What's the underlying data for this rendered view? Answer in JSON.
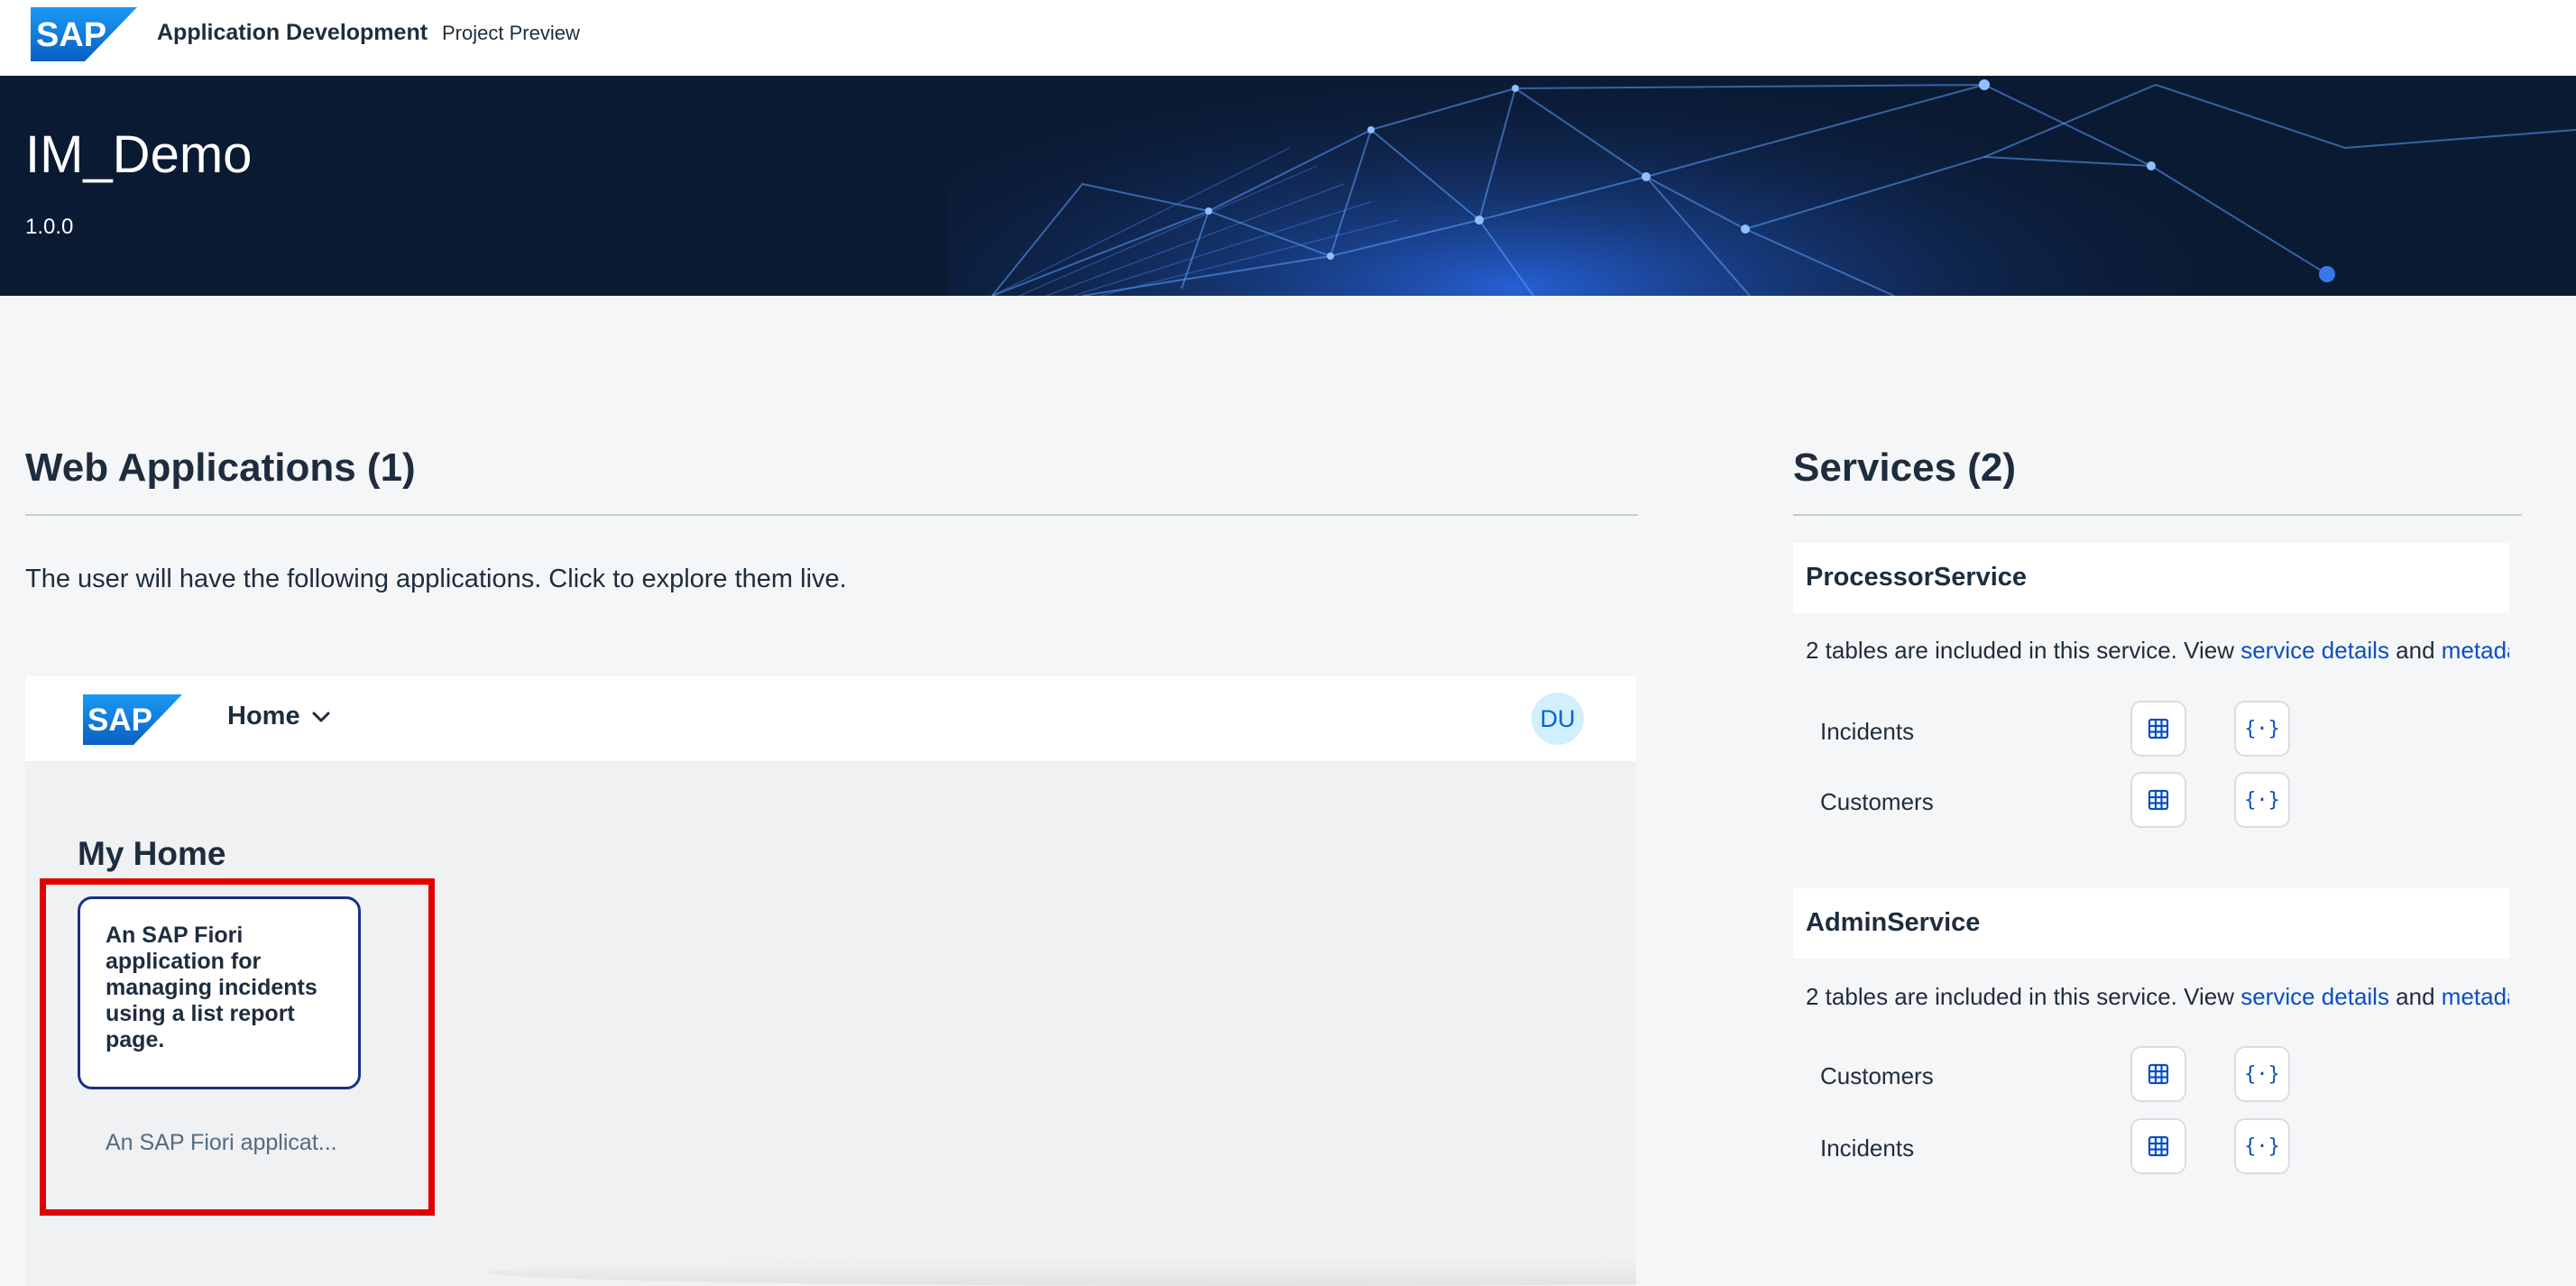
{
  "shell": {
    "logo_text": "SAP",
    "title": "Application Development",
    "subtitle": "Project Preview"
  },
  "hero": {
    "title": "IM_Demo",
    "version": "1.0.0"
  },
  "web_apps": {
    "heading": "Web Applications (1)",
    "intro": "The user will have the following applications. Click to explore them live.",
    "launchpad": {
      "logo_text": "SAP",
      "nav_label": "Home",
      "avatar_initials": "DU",
      "page_title": "My Home",
      "tiles": [
        {
          "title": "An SAP Fiori application for managing incidents using a list report page.",
          "subtitle": "An SAP Fiori applicat..."
        }
      ]
    }
  },
  "services": {
    "heading": "Services (2)",
    "items": [
      {
        "name": "ProcessorService",
        "desc_prefix": "2 tables are included in this service. View ",
        "details_link": "service details",
        "and_text": " and ",
        "metadata_link": "metadata",
        "entities": [
          "Incidents",
          "Customers"
        ]
      },
      {
        "name": "AdminService",
        "desc_prefix": "2 tables are included in this service. View ",
        "details_link": "service details",
        "and_text": " and ",
        "metadata_link": "metadata",
        "entities": [
          "Customers",
          "Incidents"
        ]
      }
    ]
  },
  "icons": {
    "table": "table-icon",
    "metadata": "curly-braces-icon"
  },
  "colors": {
    "brand_blue": "#0a6ed1",
    "link": "#0a4fc2",
    "highlight_red": "#e00000",
    "hero_bg": "#0b1a33"
  }
}
